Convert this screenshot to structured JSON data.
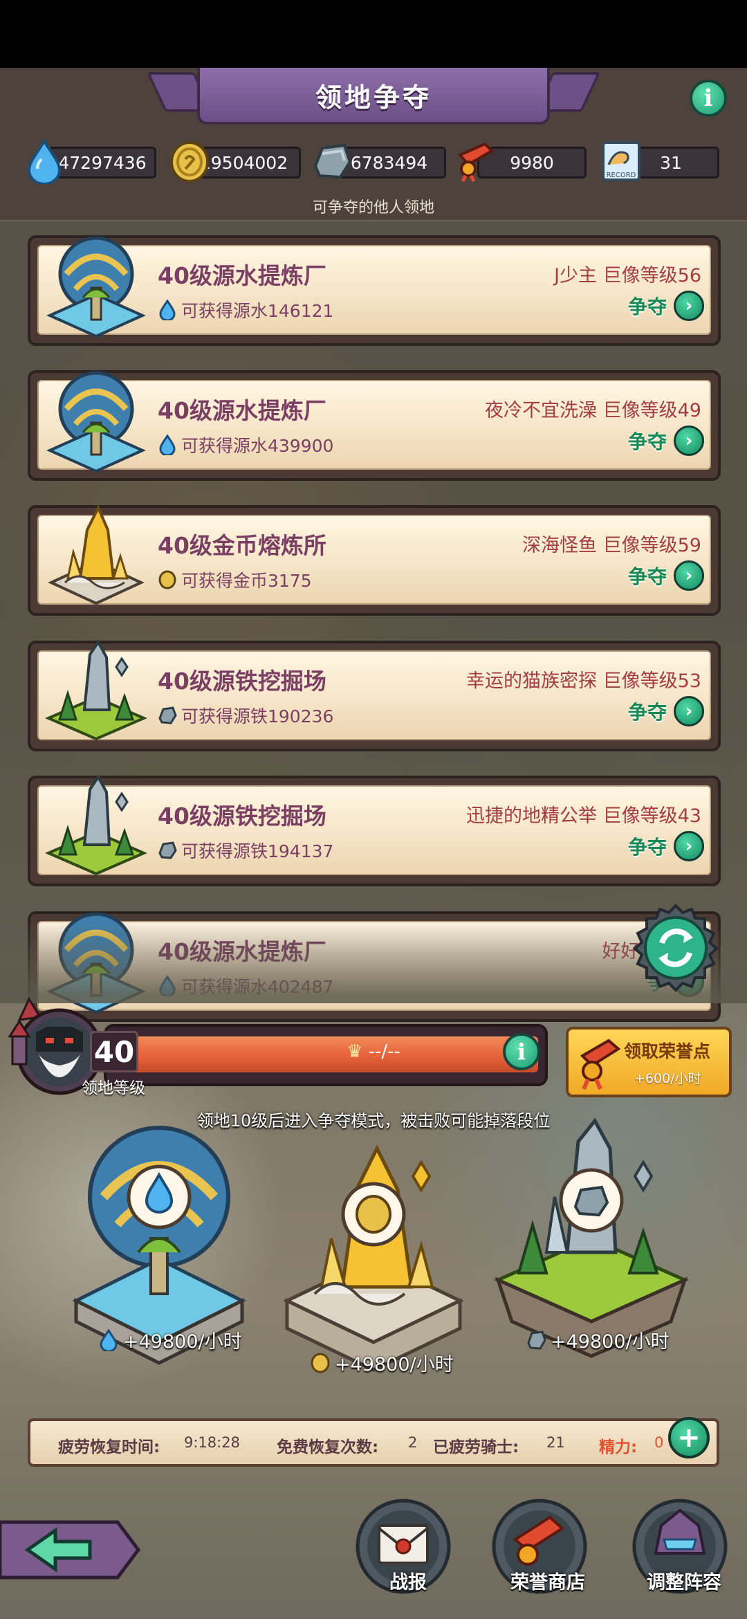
{
  "header": {
    "title": "领地争夺",
    "info_label": "i",
    "subtitle": "可争夺的他人领地"
  },
  "resources": [
    {
      "icon": "water-drop-icon",
      "value": "47297436"
    },
    {
      "icon": "gold-coin-icon",
      "value": "19504002"
    },
    {
      "icon": "iron-ore-icon",
      "value": "6783494"
    },
    {
      "icon": "honor-scroll-icon",
      "value": "9980"
    },
    {
      "icon": "record-card-icon",
      "value": "31",
      "icon_text": "RECORD"
    }
  ],
  "territories": [
    {
      "name": "40级源水提炼厂",
      "reward": "可获得源水146121",
      "owner": "J少主  巨像等级56",
      "type": "water",
      "action": "争夺"
    },
    {
      "name": "40级源水提炼厂",
      "reward": "可获得源水439900",
      "owner": "夜冷不宜洗澡  巨像等级49",
      "type": "water",
      "action": "争夺"
    },
    {
      "name": "40级金币熔炼所",
      "reward": "可获得金币3175",
      "owner": "深海怪鱼  巨像等级59",
      "type": "gold",
      "action": "争夺"
    },
    {
      "name": "40级源铁挖掘场",
      "reward": "可获得源铁190236",
      "owner": "幸运的猫族密探  巨像等级53",
      "type": "iron",
      "action": "争夺"
    },
    {
      "name": "40级源铁挖掘场",
      "reward": "可获得源铁194137",
      "owner": "迅捷的地精公举  巨像等级43",
      "type": "iron",
      "action": "争夺"
    },
    {
      "name": "40级源水提炼厂",
      "reward": "可获得源水402487",
      "owner": "好好爱林  巨",
      "type": "water",
      "action": "争"
    }
  ],
  "level": {
    "value": "40",
    "label": "领地等级",
    "progress_text": "--/--",
    "info_label": "i"
  },
  "honor_button": {
    "label": "领取荣誉点",
    "rate": "+600/小时"
  },
  "hint": "领地10级后进入争夺模式，被击败可能掉落段位",
  "production": [
    {
      "type": "water",
      "rate": "+49800/小时"
    },
    {
      "type": "gold",
      "rate": "+49800/小时"
    },
    {
      "type": "iron",
      "rate": "+49800/小时"
    }
  ],
  "fatigue": {
    "recovery_time_label": "疲劳恢复时间:",
    "recovery_time_value": "9:18:28",
    "free_recovery_label": "免费恢复次数:",
    "free_recovery_value": "2",
    "fatigued_knights_label": "已疲劳骑士:",
    "fatigued_knights_value": "21",
    "stamina_label": "精力:",
    "stamina_value": "0",
    "plus_label": "+"
  },
  "nav": {
    "battle_report": "战报",
    "honor_shop": "荣誉商店",
    "adjust_lineup": "调整阵容"
  },
  "colors": {
    "title_plate": "#7b5e98",
    "card_bg": "#f7e8cc",
    "card_text": "#7a3f62",
    "owner_text": "#a33c45",
    "action_green": "#1a8a55",
    "level_bar": "#e8613a",
    "honor_button": "#f5b935"
  }
}
